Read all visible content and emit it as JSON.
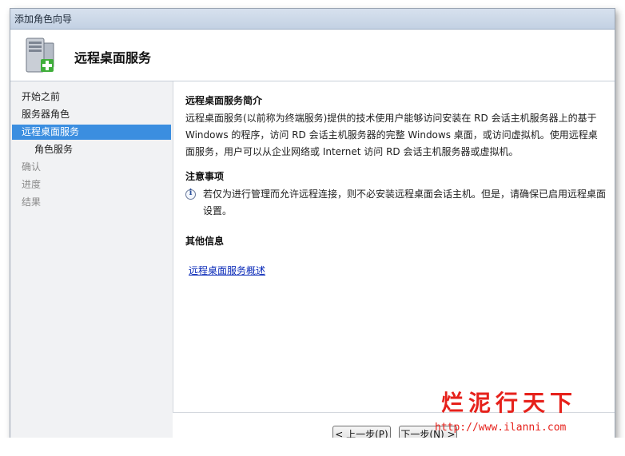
{
  "window": {
    "title": "添加角色向导"
  },
  "header": {
    "title": "远程桌面服务",
    "icon": "server-add-icon"
  },
  "nav": {
    "items": [
      {
        "label": "开始之前",
        "state": "normal"
      },
      {
        "label": "服务器角色",
        "state": "normal"
      },
      {
        "label": "远程桌面服务",
        "state": "selected"
      },
      {
        "label": "角色服务",
        "state": "sub"
      },
      {
        "label": "确认",
        "state": "disabled"
      },
      {
        "label": "进度",
        "state": "disabled"
      },
      {
        "label": "结果",
        "state": "disabled"
      }
    ]
  },
  "content": {
    "intro_heading": "远程桌面服务简介",
    "intro_text": "远程桌面服务(以前称为终端服务)提供的技术使用户能够访问安装在 RD 会话主机服务器上的基于 Windows 的程序，访问 RD 会话主机服务器的完整 Windows 桌面，或访问虚拟机。使用远程桌面服务，用户可以从企业网络或 Internet 访问 RD 会话主机服务器或虚拟机。",
    "notes_heading": "注意事项",
    "note_text": "若仅为进行管理而允许远程连接，则不必安装远程桌面会话主机。但是，请确保已启用远程桌面设置。",
    "more_heading": "其他信息",
    "link_text": "远程桌面服务概述"
  },
  "footer": {
    "back_label": "< 上一步(P)",
    "next_label": "下一步(N) >"
  },
  "watermark": {
    "text": "烂泥行天下",
    "url": "http://www.ilanni.com"
  }
}
